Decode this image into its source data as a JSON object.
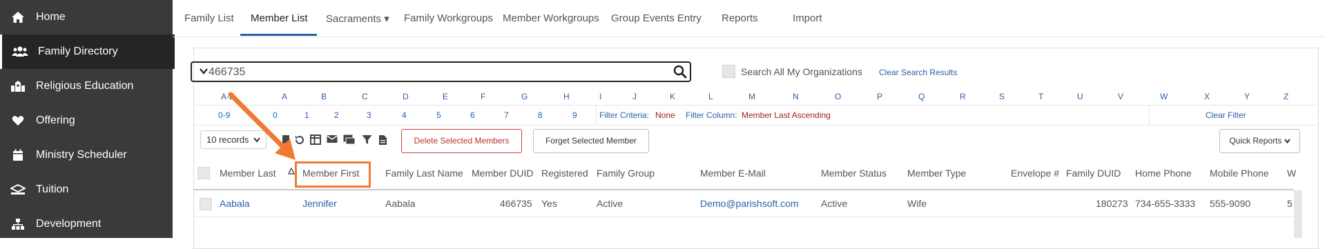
{
  "sidebar": {
    "items": [
      {
        "label": "Home",
        "icon": "home-icon"
      },
      {
        "label": "Family Directory",
        "icon": "people-icon"
      },
      {
        "label": "Religious Education",
        "icon": "school-icon"
      },
      {
        "label": "Offering",
        "icon": "heart-icon"
      },
      {
        "label": "Ministry Scheduler",
        "icon": "calendar-icon"
      },
      {
        "label": "Tuition",
        "icon": "tuition-icon"
      },
      {
        "label": "Development",
        "icon": "org-chart-icon"
      }
    ]
  },
  "nav": {
    "tabs": [
      "Family List",
      "Member List",
      "Sacraments ▾",
      "Family Workgroups",
      "Member Workgroups",
      "Group Events Entry",
      "Reports",
      "Import"
    ]
  },
  "search": {
    "value": "466735",
    "all_orgs_label": "Search All My Organizations",
    "clear_label": "Clear Search Results"
  },
  "alpha": {
    "letters": [
      "A-Z",
      "A",
      "B",
      "C",
      "D",
      "E",
      "F",
      "G",
      "H",
      "I",
      "J",
      "K",
      "L",
      "M",
      "N",
      "O",
      "P",
      "Q",
      "R",
      "S",
      "T",
      "U",
      "V",
      "W",
      "X",
      "Y",
      "Z"
    ],
    "numbers": [
      "0-9",
      "0",
      "1",
      "2",
      "3",
      "4",
      "5",
      "6",
      "7",
      "8",
      "9"
    ]
  },
  "filter": {
    "criteria_label": "Filter Criteria:",
    "criteria_value": "None",
    "column_label": "Filter Column:",
    "column_value": "Member Last Ascending",
    "clear_label": "Clear Filter"
  },
  "toolbar": {
    "records": "10 records",
    "delete_label": "Delete Selected Members",
    "forget_label": "Forget Selected Member",
    "quick_reports_label": "Quick Reports"
  },
  "table": {
    "headers": [
      "Member Last",
      "Member First",
      "Family Last Name",
      "Member DUID",
      "Registered",
      "Family Group",
      "Member E-Mail",
      "Member Status",
      "Member Type",
      "Envelope #",
      "Family DUID",
      "Home Phone",
      "Mobile Phone",
      "W"
    ],
    "rows": [
      {
        "member_last": "Aabala",
        "member_first": "Jennifer",
        "family_last": "Aabala",
        "member_duid": "466735",
        "registered": "Yes",
        "family_group": "Active",
        "email": "Demo@parishsoft.com",
        "status": "Active",
        "type": "Wife",
        "envelope": "",
        "family_duid": "180273",
        "home_phone": "734-655-3333",
        "mobile_phone": "555-9090",
        "w": "5"
      }
    ]
  },
  "colors": {
    "sidebar_bg": "#3a3a3a",
    "accent": "#2a5fa8",
    "highlight": "#f07a30",
    "danger": "#c03030"
  }
}
